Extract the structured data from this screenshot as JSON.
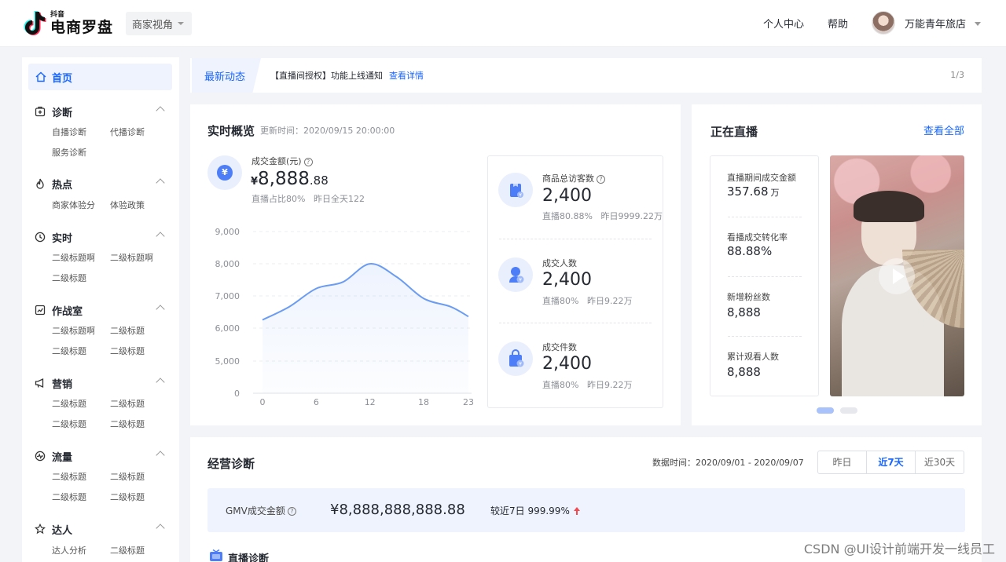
{
  "header": {
    "logo_sub": "抖音",
    "logo_main": "电商罗盘",
    "view_switch": "商家视角",
    "nav": [
      "个人中心",
      "帮助"
    ],
    "user_name": "万能青年旅店"
  },
  "sidebar": {
    "home": "首页",
    "groups": [
      {
        "title": "诊断",
        "icon": "diagnosis-icon",
        "items": [
          "自播诊断",
          "代播诊断",
          "服务诊断"
        ]
      },
      {
        "title": "热点",
        "icon": "flame-icon",
        "items": [
          "商家体验分",
          "体验政策"
        ]
      },
      {
        "title": "实时",
        "icon": "clock-icon",
        "items": [
          "二级标题啊",
          "二级标题啊",
          "二级标题"
        ]
      },
      {
        "title": "作战室",
        "icon": "chart-icon",
        "items": [
          "二级标题啊",
          "二级标题",
          "二级标题",
          "二级标题"
        ]
      },
      {
        "title": "营销",
        "icon": "megaphone-icon",
        "items": [
          "二级标题",
          "二级标题",
          "二级标题",
          "二级标题"
        ]
      },
      {
        "title": "流量",
        "icon": "traffic-icon",
        "items": [
          "二级标题",
          "二级标题",
          "二级标题",
          "二级标题"
        ]
      },
      {
        "title": "达人",
        "icon": "star-icon",
        "items": [
          "达人分析",
          "二级标题"
        ]
      }
    ]
  },
  "notice": {
    "tag": "最新动态",
    "text": "【直播间授权】功能上线通知",
    "link": "查看详情",
    "page": "1/3"
  },
  "realtime": {
    "title": "实时概览",
    "update_time": "更新时间：2020/09/15 20:00:00",
    "gmv_label": "成交金额(元)",
    "gmv_currency": "¥",
    "gmv_int": "8,888",
    "gmv_dec": ".88",
    "gmv_note_1": "直播占比80%",
    "gmv_note_2": "昨日全天122",
    "metrics": [
      {
        "label": "商品总访客数",
        "has_help": true,
        "value": "2,400",
        "note_1": "直播80.88%",
        "note_2": "昨日9999.22万",
        "icon": "bag-icon"
      },
      {
        "label": "成交人数",
        "has_help": false,
        "value": "2,400",
        "note_1": "直播80%",
        "note_2": "昨日9.22万",
        "icon": "user-icon"
      },
      {
        "label": "成交件数",
        "has_help": false,
        "value": "2,400",
        "note_1": "直播80%",
        "note_2": "昨日9.22万",
        "icon": "lock-bag-icon"
      }
    ]
  },
  "chart_data": {
    "type": "area",
    "x": [
      0,
      3,
      6,
      9,
      12,
      15,
      18,
      21,
      23
    ],
    "values": [
      6250,
      6650,
      7200,
      7400,
      7950,
      7550,
      6900,
      6650,
      6350
    ],
    "xticks": [
      "0",
      "6",
      "12",
      "18",
      "23"
    ],
    "xtick_values": [
      0,
      6,
      12,
      18,
      23
    ],
    "yticks": [
      "9,000",
      "8,000",
      "7,000",
      "6,000",
      "5,000",
      "0"
    ],
    "xlim": [
      0,
      23
    ],
    "grid": true,
    "color": "#6b9cf2"
  },
  "live": {
    "title": "正在直播",
    "view_all": "查看全部",
    "stats": [
      {
        "label": "直播期间成交金额",
        "value": "357.68",
        "unit": "万"
      },
      {
        "label": "看播成交转化率",
        "value": "88.88%",
        "unit": ""
      },
      {
        "label": "新增粉丝数",
        "value": "8,888",
        "unit": ""
      },
      {
        "label": "累计观看人数",
        "value": "8,888",
        "unit": ""
      }
    ]
  },
  "business": {
    "title": "经营诊断",
    "data_time": "数据时间：2020/09/01 - 2020/09/07",
    "ranges": [
      "昨日",
      "近7天",
      "近30天"
    ],
    "active_range": "近7天",
    "gmv_label": "GMV成交金额",
    "gmv_value": "¥8,888,888,888.88",
    "compare": "较近7日 999.99%",
    "section": "直播诊断"
  },
  "watermark": "CSDN @UI设计前端开发一线员工",
  "colors": {
    "accent": "#1966ff",
    "up": "#f5484f"
  }
}
